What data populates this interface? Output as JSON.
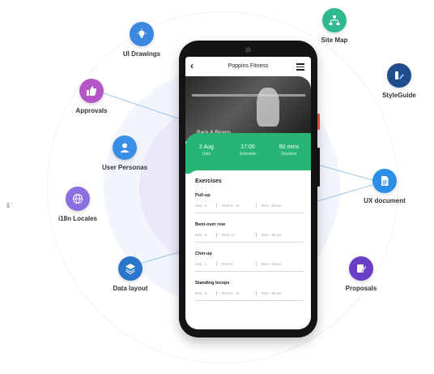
{
  "features": [
    {
      "id": "ui-drawings",
      "label": "UI Drawings",
      "icon": "lightbulb-icon",
      "color": "#3b88e0"
    },
    {
      "id": "site-map",
      "label": "Site Map",
      "icon": "sitemap-icon",
      "color": "#2fb98f"
    },
    {
      "id": "approvals",
      "label": "Approvals",
      "icon": "thumbs-up-icon",
      "color": "#b455c8"
    },
    {
      "id": "styleguide",
      "label": "StyleGuide",
      "icon": "styleguide-icon",
      "color": "#1e4c8c"
    },
    {
      "id": "user-personas",
      "label": "User Personas",
      "icon": "user-icon",
      "color": "#3a8ee6"
    },
    {
      "id": "i18n-locales",
      "label": "i18n Locales",
      "icon": "globe-icon",
      "color": "#8b6fe0"
    },
    {
      "id": "ux-document",
      "label": "UX document",
      "icon": "document-icon",
      "color": "#2b8fe8"
    },
    {
      "id": "data-layout",
      "label": "Data layout",
      "icon": "layers-icon",
      "color": "#2a74c9"
    },
    {
      "id": "proposals",
      "label": "Proposals",
      "icon": "edit-document-icon",
      "color": "#6a3fc6"
    }
  ],
  "edge_glyph": "š",
  "app": {
    "title": "Poppins Fitness",
    "hero_text": "Back & Biceps",
    "stats": [
      {
        "value": "2 Aug",
        "label": "Date"
      },
      {
        "value": "17:00",
        "label": "Schedule"
      },
      {
        "value": "60 mins",
        "label": "Duration"
      }
    ],
    "exercises_title": "Exercises",
    "exercises": [
      {
        "name": "Pull-up",
        "sets": "Sets - 5",
        "reps": "Reps 8 - 10",
        "rest": "Rest - 60 sec"
      },
      {
        "name": "Bent-over row",
        "sets": "Sets - 3",
        "reps": "Reps 10",
        "rest": "Rest - 60 sec"
      },
      {
        "name": "Chin-up",
        "sets": "Sets - 2",
        "reps": "Reps 8",
        "rest": "Rest - 60 sec"
      },
      {
        "name": "Standing biceps",
        "sets": "Sets - 3",
        "reps": "Reps 8 - 10",
        "rest": "Rest - 60 sec"
      }
    ]
  },
  "colors": {
    "accent_green": "#26b575",
    "ring_purple": "#ece8f9"
  }
}
